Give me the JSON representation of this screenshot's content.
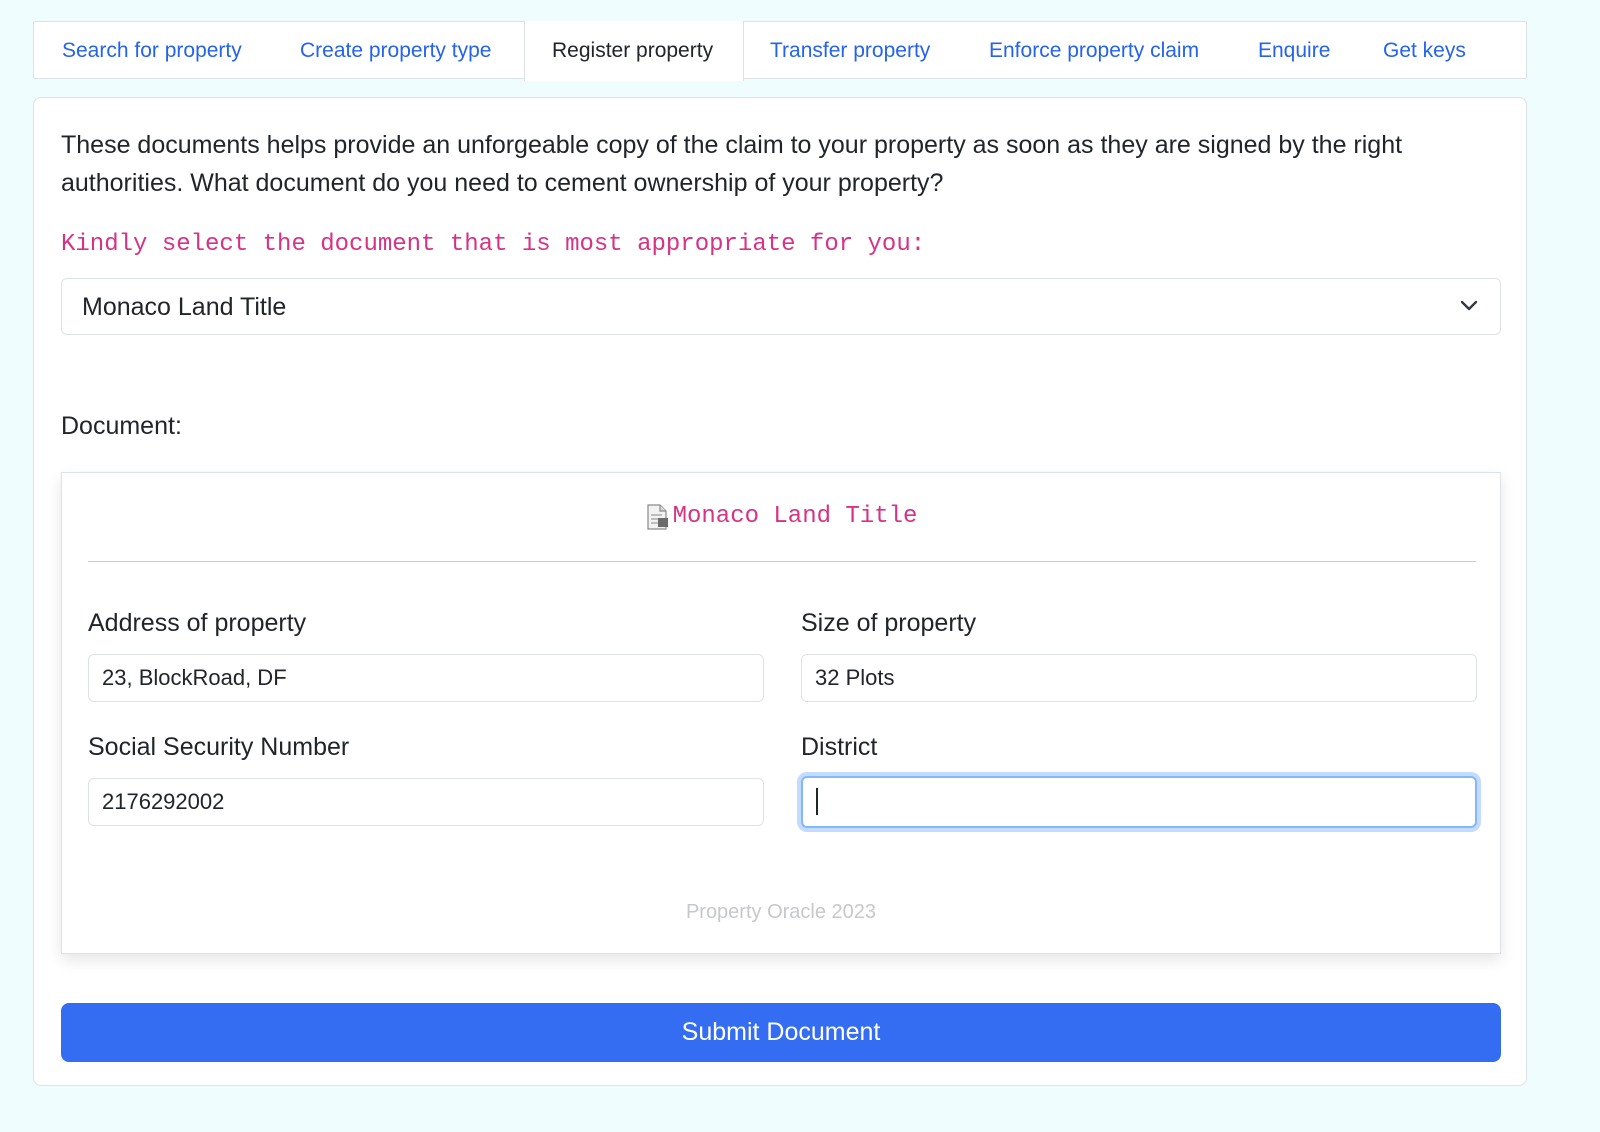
{
  "tabs": [
    {
      "label": "Search for property"
    },
    {
      "label": "Create property type"
    },
    {
      "label": "Register property"
    },
    {
      "label": "Transfer property"
    },
    {
      "label": "Enforce property claim"
    },
    {
      "label": "Enquire"
    },
    {
      "label": "Get keys"
    }
  ],
  "active_tab": "Register property",
  "intro": "These documents helps provide an unforgeable copy of the claim to your property as soon as they are signed by the right authorities. What document do you need to cement ownership of your property?",
  "select_prompt": "Kindly select the document that is most appropriate for you:",
  "document_select": {
    "value": "Monaco Land Title",
    "icon": "chevron-down-icon"
  },
  "document_label": "Document:",
  "document": {
    "title": "Monaco Land Title",
    "icon": "document-icon",
    "fields": {
      "address": {
        "label": "Address of property",
        "value": "23, BlockRoad, DF"
      },
      "size": {
        "label": "Size of property",
        "value": "32 Plots"
      },
      "ssn": {
        "label": "Social Security Number",
        "value": "2176292002"
      },
      "district": {
        "label": "District",
        "value": ""
      }
    },
    "footer": "Property Oracle 2023"
  },
  "submit_label": "Submit Document",
  "colors": {
    "background": "#f0fdff",
    "link": "#2563eb",
    "accent_pink": "#d63384",
    "button": "#346df1",
    "focus_ring": "#86b7fe"
  }
}
